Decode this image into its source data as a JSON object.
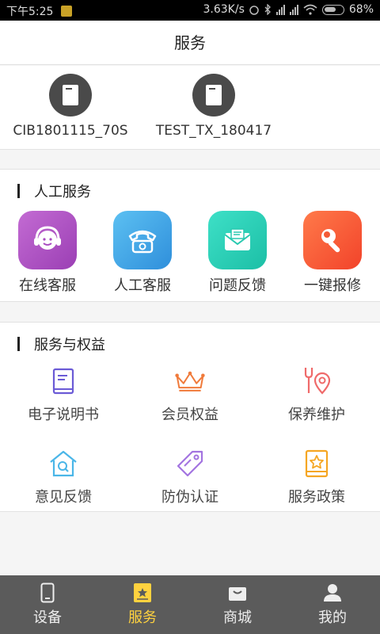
{
  "status_bar": {
    "time": "下午5:25",
    "speed": "3.63K/s",
    "battery": "68%"
  },
  "header": {
    "title": "服务"
  },
  "devices": [
    {
      "name": "CIB1801115_70S",
      "icon": "device-icon"
    },
    {
      "name": "TEST_TX_180417",
      "icon": "device-icon"
    }
  ],
  "manual_service": {
    "title": "人工服务",
    "items": [
      {
        "label": "在线客服",
        "icon": "headset-icon",
        "color": "#b44fc4"
      },
      {
        "label": "人工客服",
        "icon": "telephone-icon",
        "color": "#3fa3e6"
      },
      {
        "label": "问题反馈",
        "icon": "mail-icon",
        "color": "#27d0b8"
      },
      {
        "label": "一键报修",
        "icon": "wrench-icon",
        "color": "#ff5e3a"
      }
    ]
  },
  "benefits": {
    "title": "服务与权益",
    "items": [
      {
        "label": "电子说明书",
        "icon": "book-icon",
        "color": "#6b5bd6"
      },
      {
        "label": "会员权益",
        "icon": "crown-icon",
        "color": "#f07a3a"
      },
      {
        "label": "保养维护",
        "icon": "maintenance-location-icon",
        "color": "#ef6a6a"
      },
      {
        "label": "意见反馈",
        "icon": "house-search-icon",
        "color": "#4ab6e8"
      },
      {
        "label": "防伪认证",
        "icon": "tag-icon",
        "color": "#a374e0"
      },
      {
        "label": "服务政策",
        "icon": "star-badge-icon",
        "color": "#f5a623"
      }
    ]
  },
  "bottom_nav": {
    "items": [
      {
        "label": "设备",
        "icon": "phone-icon"
      },
      {
        "label": "服务",
        "icon": "service-star-icon",
        "active": true
      },
      {
        "label": "商城",
        "icon": "shopping-bag-icon"
      },
      {
        "label": "我的",
        "icon": "user-icon"
      }
    ]
  }
}
